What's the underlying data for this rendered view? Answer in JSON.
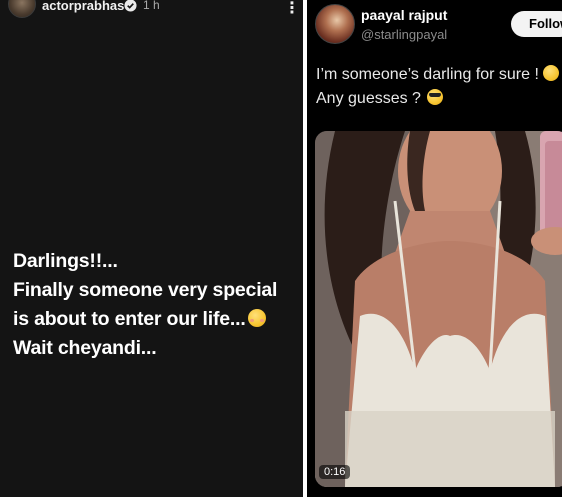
{
  "left_post": {
    "username": "actorprabhas",
    "time": "1 h",
    "menu_icon": "more-vertical-icon",
    "verified_icon": "verified-badge-icon",
    "lines": [
      "Darlings!!...",
      "Finally someone very special",
      "is about to enter our life...",
      "Wait cheyandi..."
    ],
    "line3_emoji": "relieved-face-emoji"
  },
  "tweet": {
    "display_name": "paayal rajput",
    "handle": "@starlingpayal",
    "follow_label": "Follow",
    "line1": "I’m someone’s darling for sure ! ",
    "line1_emoji": "pleading-face-emoji",
    "line2": "Any guesses ? ",
    "line2_emoji": "sunglasses-face-emoji",
    "video_time": "0:16"
  },
  "colors": {
    "left_bg": "#141414",
    "right_bg": "#000000",
    "divider": "#ffffff",
    "follow_bg": "#f3f3f3",
    "handle_gray": "#8b8b8b"
  }
}
